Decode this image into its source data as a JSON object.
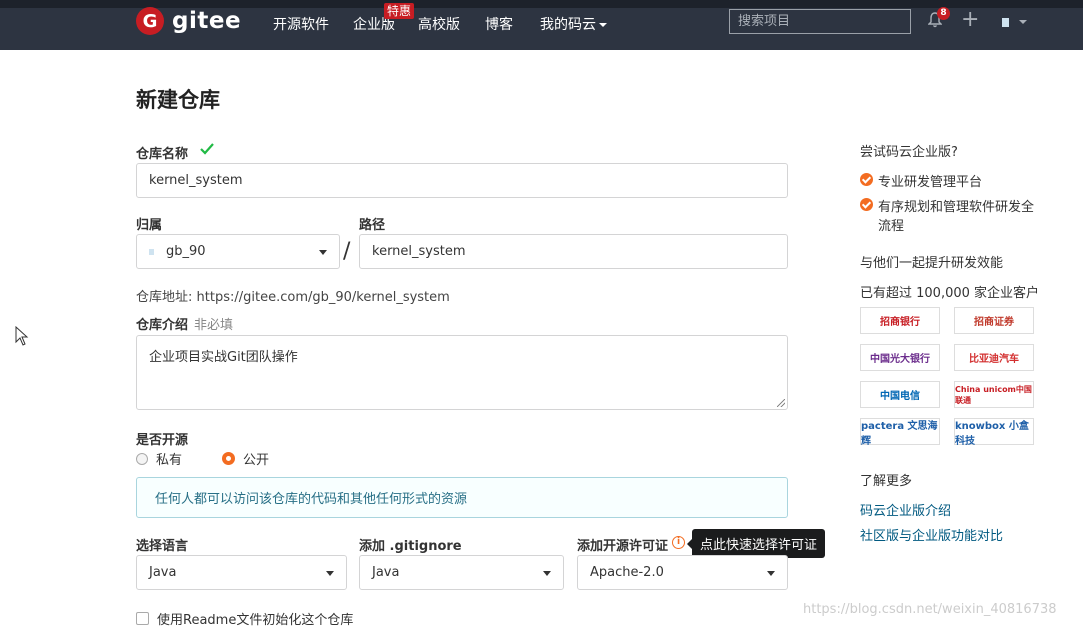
{
  "header": {
    "logo_text": "gitee",
    "logo_letter": "G",
    "nav": [
      "开源软件",
      "企业版",
      "高校版",
      "博客",
      "我的码云"
    ],
    "nav_badge": "特惠",
    "search_placeholder": "搜索项目",
    "notification_count": "8",
    "plus": "+"
  },
  "form": {
    "title": "新建仓库",
    "repo_name_label": "仓库名称",
    "repo_name_value": "kernel_system",
    "owner_label": "归属",
    "owner_value": "gb_90",
    "path_label": "路径",
    "path_value": "kernel_system",
    "slash": "/",
    "address_label": "仓库地址:",
    "address_value": "https://gitee.com/gb_90/kernel_system",
    "desc_label": "仓库介绍",
    "desc_optional": "非必填",
    "desc_value": "企业项目实战Git团队操作",
    "public_label": "是否开源",
    "private_option": "私有",
    "public_option": "公开",
    "public_selected": true,
    "notice": "任何人都可以访问该仓库的代码和其他任何形式的资源",
    "lang_label": "选择语言",
    "lang_value": "Java",
    "gitignore_label": "添加 .gitignore",
    "gitignore_value": "Java",
    "license_label": "添加开源许可证",
    "license_value": "Apache-2.0",
    "license_tooltip": "点此快速选择许可证",
    "readme_label": "使用Readme文件初始化这个仓库"
  },
  "sidebar": {
    "try_enterprise": "尝试码云企业版?",
    "features": [
      "专业研发管理平台",
      "有序规划和管理软件研发全流程"
    ],
    "together": "与他们一起提升研发效能",
    "customers": "已有超过 100,000 家企业客户",
    "logos": [
      "招商银行",
      "招商证券",
      "中国光大银行",
      "比亚迪汽车",
      "中国电信",
      "China unicom中国联通",
      "pactera 文思海辉",
      "knowbox 小盒科技"
    ],
    "learn_more": "了解更多",
    "links": [
      "码云企业版介绍",
      "社区版与企业版功能对比"
    ]
  },
  "watermark": "https://blog.csdn.net/weixin_40816738",
  "colors": {
    "topbar": "#2d3441",
    "brand_red": "#c71d23",
    "accent_orange": "#f36c21",
    "link_blue": "#005980"
  }
}
